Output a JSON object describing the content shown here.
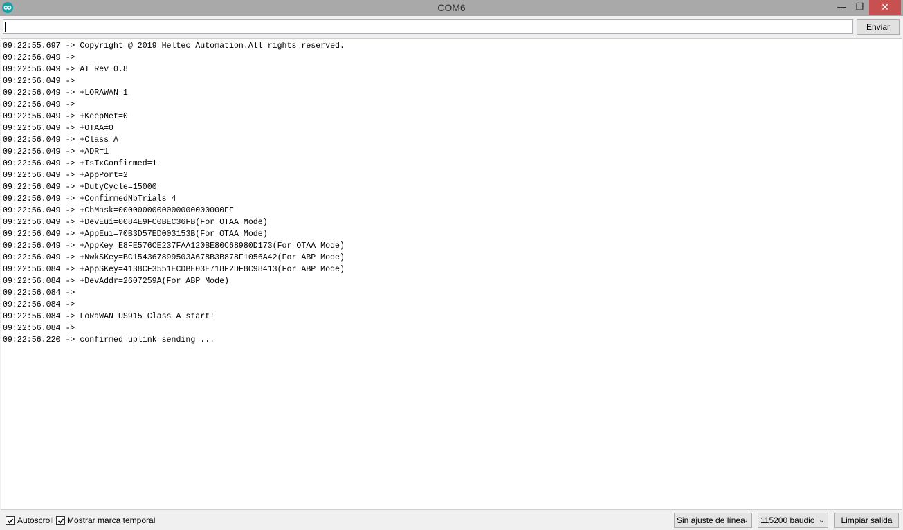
{
  "window": {
    "title": "COM6",
    "app_icon": "arduino-infinity-icon",
    "controls": {
      "minimize": "—",
      "maximize": "❐",
      "close": "✕"
    }
  },
  "send": {
    "input_value": "",
    "button_label": "Enviar"
  },
  "output": {
    "lines": [
      "09:22:55.697 -> Copyright @ 2019 Heltec Automation.All rights reserved.",
      "09:22:56.049 -> ",
      "09:22:56.049 -> AT Rev 0.8",
      "09:22:56.049 -> ",
      "09:22:56.049 -> +LORAWAN=1",
      "09:22:56.049 -> ",
      "09:22:56.049 -> +KeepNet=0",
      "09:22:56.049 -> +OTAA=0",
      "09:22:56.049 -> +Class=A",
      "09:22:56.049 -> +ADR=1",
      "09:22:56.049 -> +IsTxConfirmed=1",
      "09:22:56.049 -> +AppPort=2",
      "09:22:56.049 -> +DutyCycle=15000",
      "09:22:56.049 -> +ConfirmedNbTrials=4",
      "09:22:56.049 -> +ChMask=0000000000000000000000FF",
      "09:22:56.049 -> +DevEui=0084E9FC0BEC36FB(For OTAA Mode)",
      "09:22:56.049 -> +AppEui=70B3D57ED003153B(For OTAA Mode)",
      "09:22:56.049 -> +AppKey=E8FE576CE237FAA120BE80C68980D173(For OTAA Mode)",
      "09:22:56.049 -> +NwkSKey=BC154367899503A678B3B878F1056A42(For ABP Mode)",
      "09:22:56.084 -> +AppSKey=4138CF3551ECDBE03E718F2DF8C98413(For ABP Mode)",
      "09:22:56.084 -> +DevAddr=2607259A(For ABP Mode)",
      "09:22:56.084 -> ",
      "09:22:56.084 -> ",
      "09:22:56.084 -> LoRaWAN US915 Class A start!",
      "09:22:56.084 -> ",
      "09:22:56.220 -> confirmed uplink sending ..."
    ]
  },
  "footer": {
    "autoscroll": {
      "label": "Autoscroll",
      "checked": true
    },
    "timestamp": {
      "label": "Mostrar marca temporal",
      "checked": true
    },
    "line_ending": {
      "selected": "Sin ajuste de línea"
    },
    "baud": {
      "selected": "115200 baudio"
    },
    "clear_button": "Limpiar salida"
  }
}
